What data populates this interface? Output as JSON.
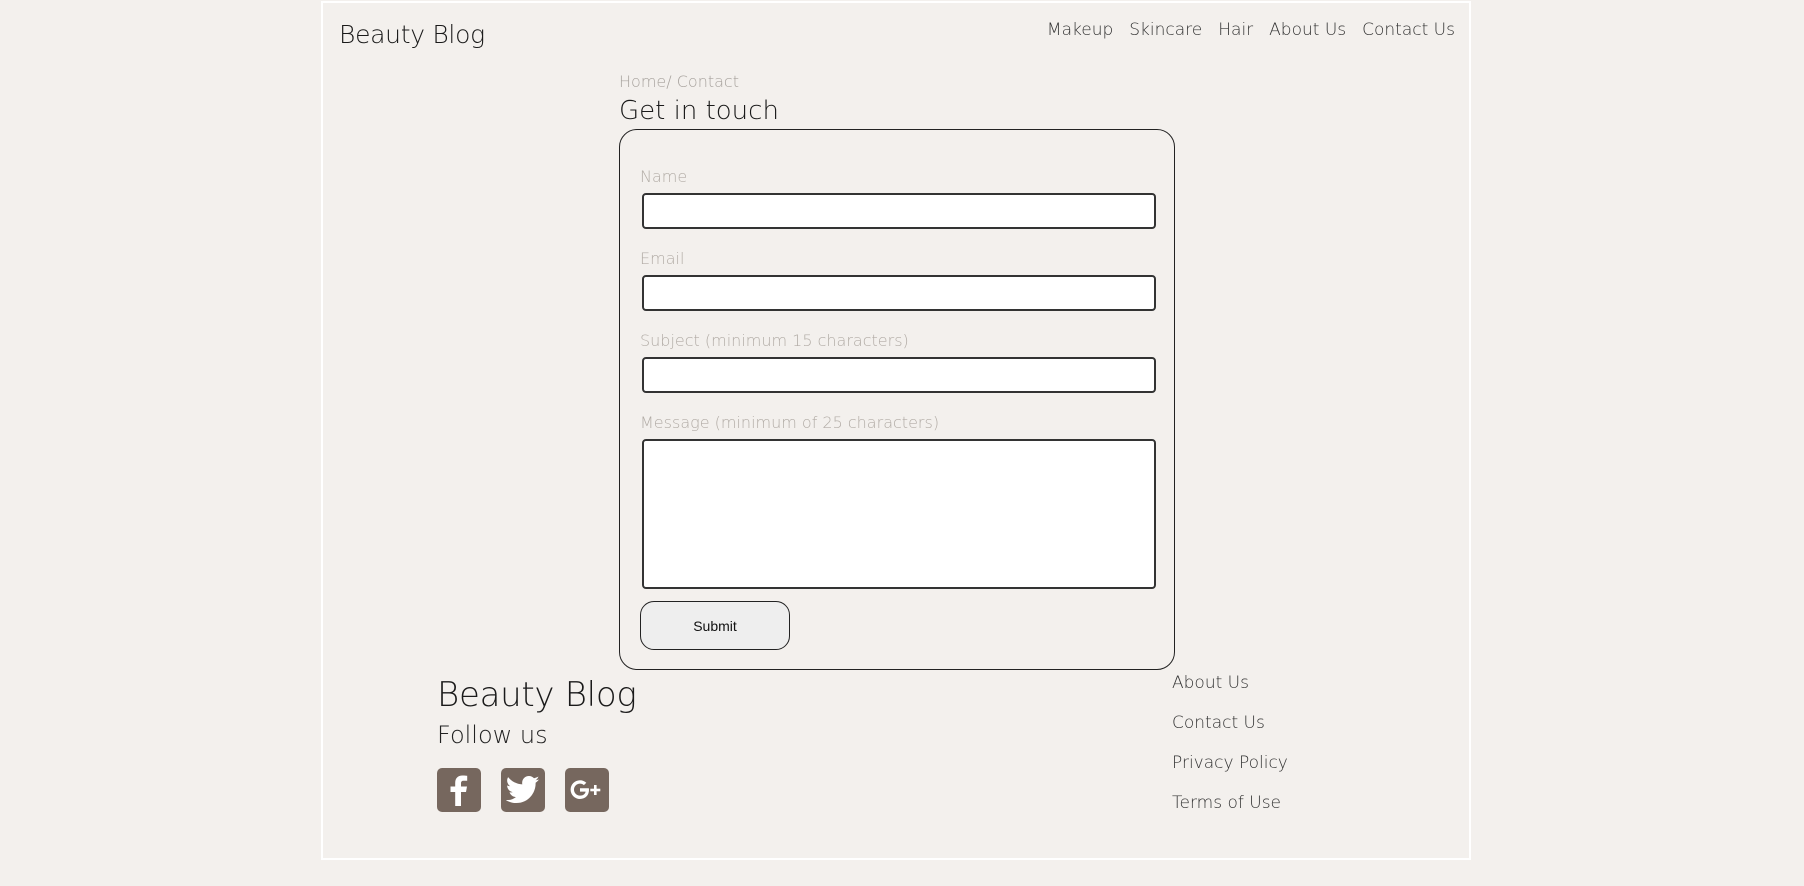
{
  "header": {
    "brand": "Beauty Blog",
    "nav": [
      "Makeup",
      "Skincare",
      "Hair",
      "About Us",
      "Contact Us"
    ]
  },
  "breadcrumb": {
    "home": "Home",
    "separator": "/ ",
    "current": "Contact"
  },
  "page_title": "Get in touch",
  "form": {
    "name_label": "Name",
    "name_value": "",
    "email_label": "Email",
    "email_value": "",
    "subject_label": "Subject (minimum 15 characters)",
    "subject_value": "",
    "message_label": "Message (minimum of 25 characters)",
    "message_value": "",
    "submit_label": "Submit"
  },
  "footer": {
    "brand": "Beauty Blog",
    "follow_label": "Follow us",
    "socials": [
      "facebook-icon",
      "twitter-icon",
      "google-plus-icon"
    ],
    "links": [
      "About Us",
      "Contact Us",
      "Privacy Policy",
      "Terms of Use"
    ]
  },
  "colors": {
    "background": "#f3f0ed",
    "social_icon_bg": "#76675e",
    "muted_text": "#a8a39e"
  }
}
